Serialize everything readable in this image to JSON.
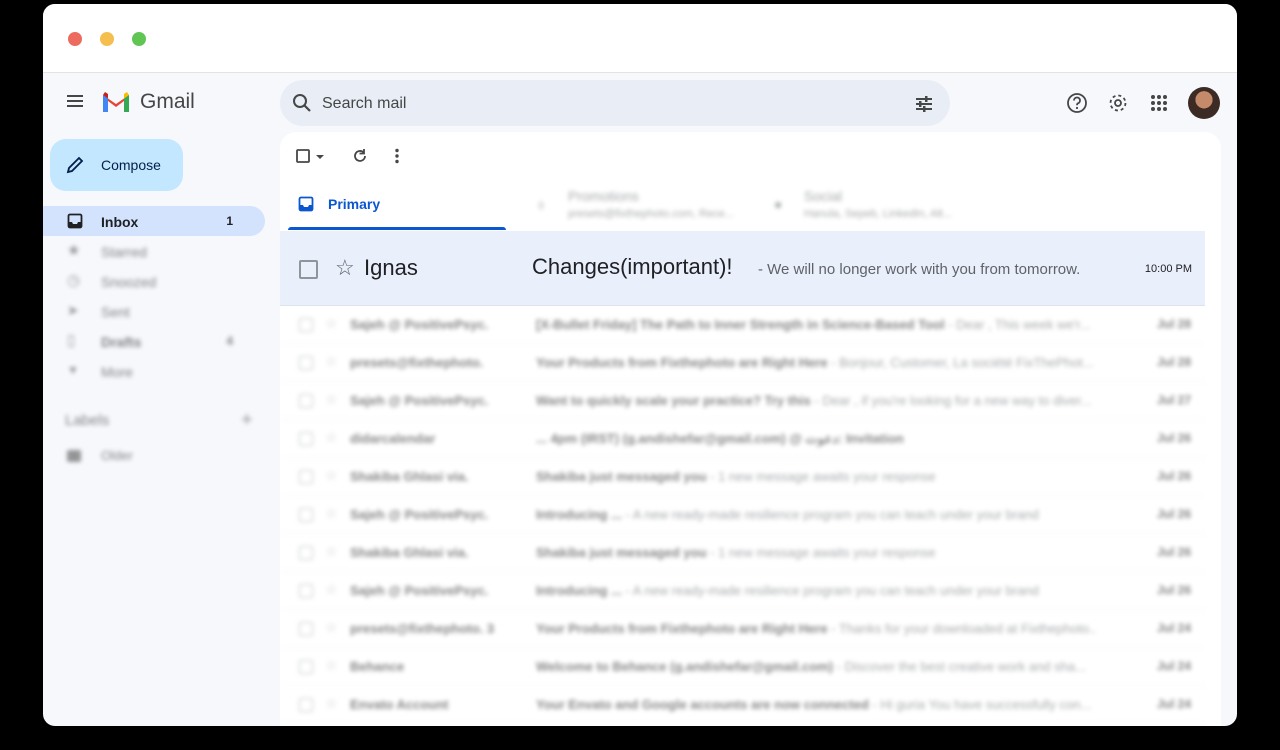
{
  "app": {
    "name": "Gmail"
  },
  "search": {
    "placeholder": "Search mail"
  },
  "compose": {
    "label": "Compose"
  },
  "sidebar": {
    "items": [
      {
        "label": "Inbox",
        "count": "1",
        "icon": "inbox-icon",
        "active": true
      },
      {
        "label": "Starred",
        "count": "",
        "icon": "star-icon"
      },
      {
        "label": "Snoozed",
        "count": "",
        "icon": "clock-icon"
      },
      {
        "label": "Sent",
        "count": "",
        "icon": "send-icon"
      },
      {
        "label": "Drafts",
        "count": "4",
        "icon": "draft-icon"
      },
      {
        "label": "More",
        "count": "",
        "icon": "chevron-down-icon"
      }
    ],
    "labels_title": "Labels",
    "labels": [
      {
        "name": "Older"
      }
    ]
  },
  "tabs": [
    {
      "label": "Primary",
      "sub": ""
    },
    {
      "label": "Promotions",
      "sub": "presets@fixthephoto.com, Rece..."
    },
    {
      "label": "Social",
      "sub": "Hanula, Sepeb, LinkedIn, Alt..."
    }
  ],
  "featured": {
    "sender": "Ignas",
    "subject": "Changes(important)!",
    "snippet": " - We will no longer work with you from tomorrow.",
    "date": "10:00 PM"
  },
  "emails": [
    {
      "sender": "Sajeh @ PositivePsyc.",
      "subject": "[X-Bullet Friday] The Path to Inner Strength in Science-Based Tool",
      "snippet": " - Dear , This week we'r...",
      "date": "Jul 28"
    },
    {
      "sender": "presets@fixthephoto.",
      "subject": "Your Products from Fixthephoto are Right Here",
      "snippet": " - Bonjour, Customer, La société FixThePhot...",
      "date": "Jul 28"
    },
    {
      "sender": "Sajeh @ PositivePsyc.",
      "subject": "Want to quickly scale your practice? Try this",
      "snippet": " - Dear , if you're looking for a new way to diver...",
      "date": "Jul 27"
    },
    {
      "sender": "didarcalendar",
      "subject": "... 4pm (IRST) (g.andishefar@gmail.com) @ دعوت: Invitation",
      "snippet": "",
      "date": "Jul 26"
    },
    {
      "sender": "Shakiba Ghlasi via.",
      "subject": "Shakiba just messaged you",
      "snippet": " - 1 new message awaits your response",
      "date": "Jul 26"
    },
    {
      "sender": "Sajeh @ PositivePsyc.",
      "subject": "Introducing ... ",
      "snippet": " - A new ready-made resilience program you can teach under your brand",
      "date": "Jul 26"
    },
    {
      "sender": "Shakiba Ghlasi via.",
      "subject": "Shakiba just messaged you",
      "snippet": " - 1 new message awaits your response",
      "date": "Jul 26"
    },
    {
      "sender": "Sajeh @ PositivePsyc.",
      "subject": "Introducing ... ",
      "snippet": " - A new ready-made resilience program you can teach under your brand",
      "date": "Jul 26"
    },
    {
      "sender": "presets@fixthephoto. 3",
      "subject": "Your Products from Fixthephoto are Right Here",
      "snippet": " - Thanks for your downloaded at Fixthephoto...",
      "date": "Jul 24"
    },
    {
      "sender": "Behance",
      "subject": "Welcome to Behance (g.andishefar@gmail.com)",
      "snippet": " - Discover the best creative work and sha...",
      "date": "Jul 24"
    },
    {
      "sender": "Envato Account",
      "subject": "Your Envato and Google accounts are now connected",
      "snippet": " - Hi guria You have successfully con...",
      "date": "Jul 24"
    }
  ]
}
